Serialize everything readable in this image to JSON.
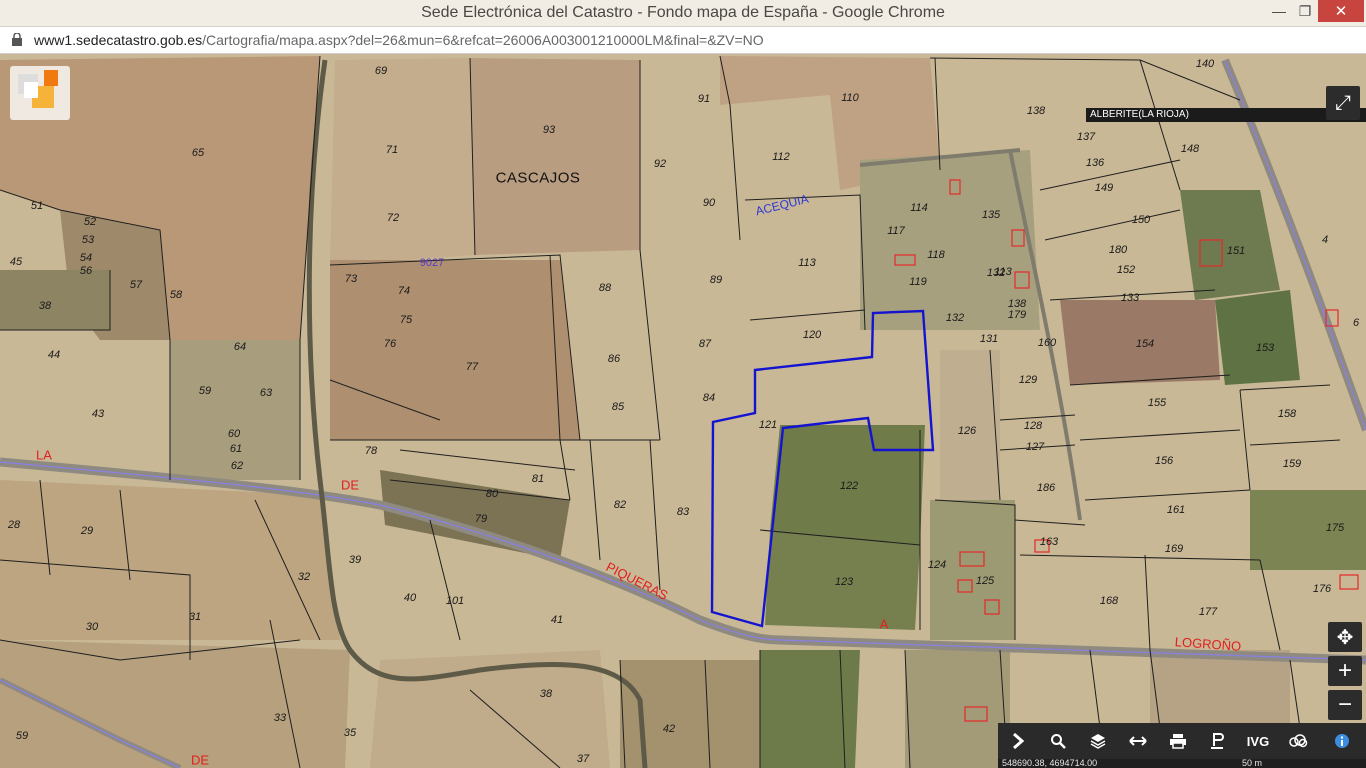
{
  "window": {
    "title": "Sede Electrónica del Catastro - Fondo mapa de España - Google Chrome",
    "min_symbol": "—",
    "max_symbol": "❐",
    "close_symbol": "✕"
  },
  "address": {
    "host": "www1.sedecatastro.gob.es",
    "path": "/Cartografia/mapa.aspx?del=26&mun=6&refcat=26006A003001210000LM&final=&ZV=NO"
  },
  "map": {
    "municipality": "ALBERITE(LA RIOJA)",
    "place_name": "CASCAJOS",
    "water_label": "ACEQUIA",
    "purple_label": "9027",
    "road_labels": [
      "LA",
      "DE",
      "PIQUERAS",
      "A",
      "LOGROÑO",
      "DE"
    ],
    "plot_numbers": [
      "69",
      "91",
      "110",
      "138",
      "140",
      "93",
      "65",
      "71",
      "92",
      "112",
      "137",
      "136",
      "148",
      "149",
      "51",
      "52",
      "53",
      "54",
      "45",
      "56",
      "72",
      "90",
      "114",
      "113",
      "135",
      "117",
      "150",
      "151",
      "4",
      "180",
      "73",
      "74",
      "113",
      "118",
      "132",
      "152",
      "57",
      "58",
      "38",
      "88",
      "89",
      "119",
      "133",
      "75",
      "138",
      "179",
      "76",
      "120",
      "132",
      "131",
      "160",
      "154",
      "6",
      "153",
      "44",
      "64",
      "86",
      "87",
      "77",
      "129",
      "43",
      "59",
      "63",
      "84",
      "155",
      "158",
      "85",
      "121",
      "126",
      "60",
      "61",
      "62",
      "128",
      "127",
      "156",
      "159",
      "78",
      "81",
      "122",
      "186",
      "80",
      "82",
      "83",
      "161",
      "175",
      "79",
      "163",
      "169",
      "28",
      "29",
      "39",
      "124",
      "32",
      "125",
      "177",
      "176",
      "168",
      "40",
      "101",
      "41",
      "123",
      "31",
      "30",
      "33",
      "35",
      "38",
      "37",
      "42",
      "59"
    ],
    "scale_label": "50 m",
    "coordinates": "548690.38, 4694714.00"
  },
  "toolbar": {
    "items": [
      "›",
      "search",
      "layers",
      "measure",
      "print",
      "pin",
      "IVG",
      "cloud",
      "info"
    ],
    "ivg_label": "IVG"
  },
  "controls": {
    "fullscreen": "⤢",
    "pan": "✥",
    "zoom_in": "+",
    "zoom_out": "−"
  },
  "colors": {
    "selected_parcel": "#1414d0",
    "parcel_line": "#222222",
    "road_red": "#e02020",
    "purple_line": "#8a7fe6"
  }
}
